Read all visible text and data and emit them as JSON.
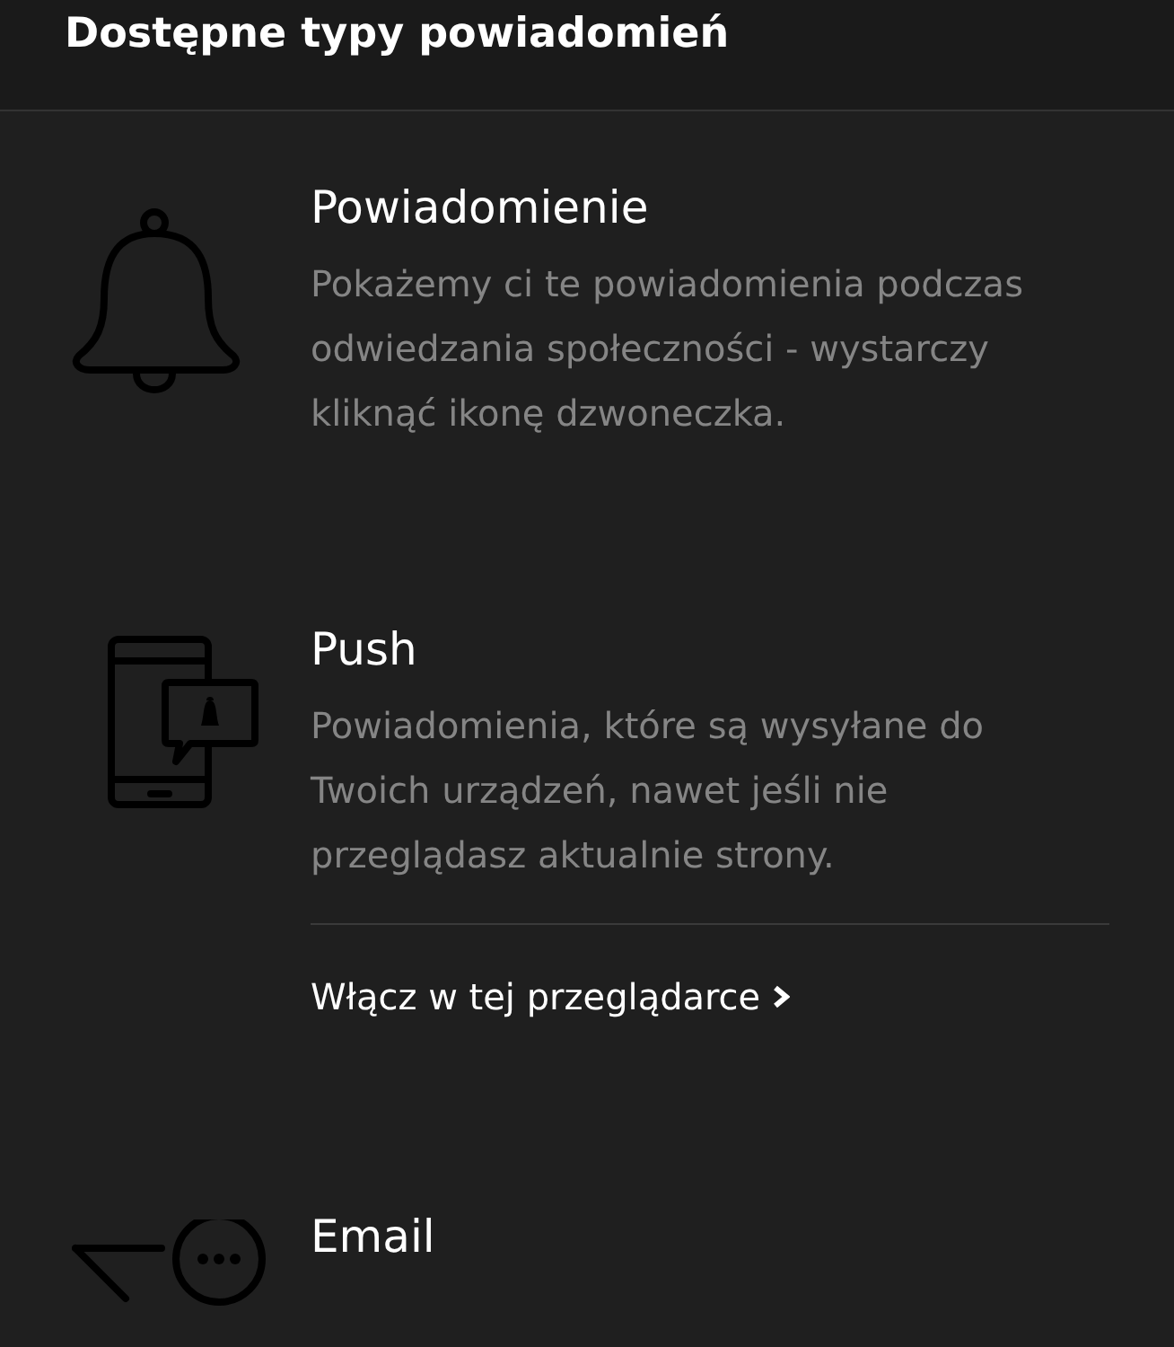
{
  "header": {
    "title": "Dostępne typy powiadomień"
  },
  "types": [
    {
      "kind": "bell",
      "title": "Powiadomienie",
      "description": "Pokażemy ci te powiadomienia podczas odwiedzania społeczności - wystarczy kliknąć ikonę dzwoneczka."
    },
    {
      "kind": "push",
      "title": "Push",
      "description": "Powiadomienia, które są wysyłane do Twoich urządzeń, nawet jeśli nie przeglądasz aktualnie strony.",
      "link": "Włącz w tej przeglądarce"
    },
    {
      "kind": "email",
      "title": "Email"
    }
  ]
}
